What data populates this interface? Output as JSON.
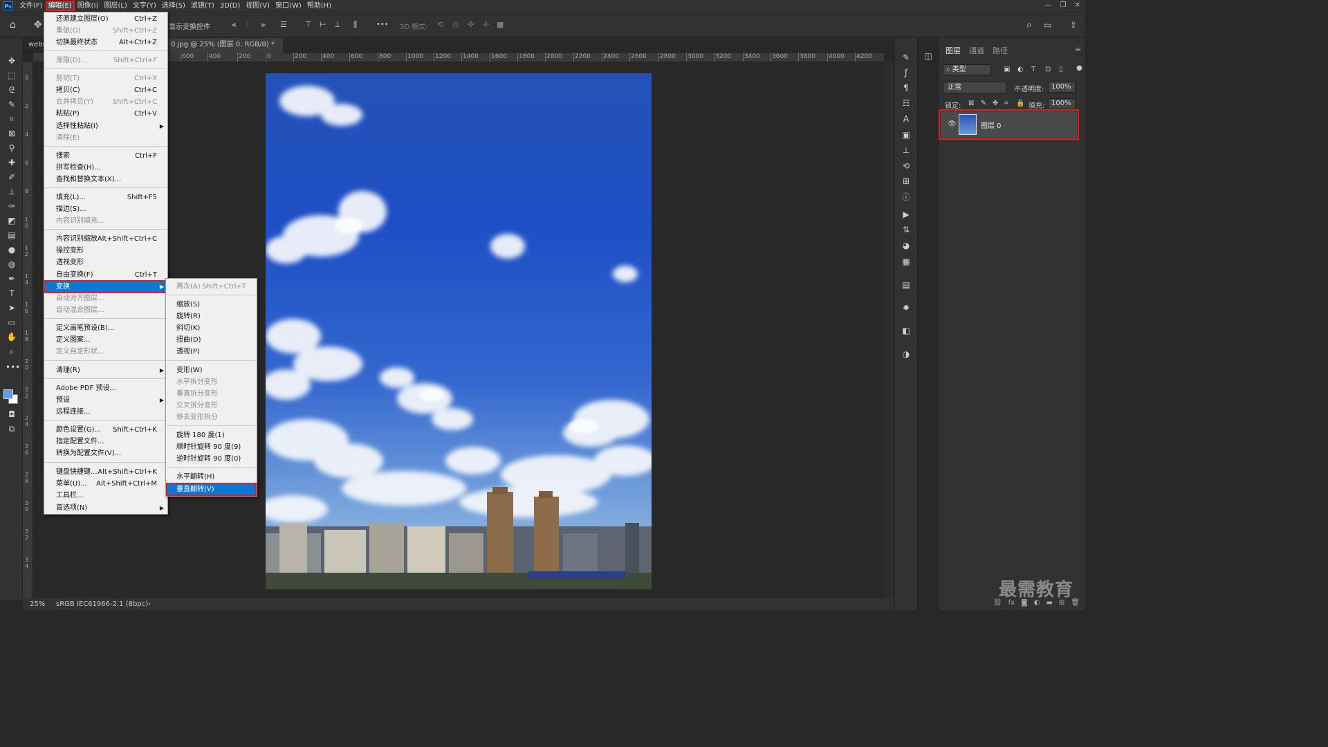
{
  "app": {
    "logo": "Ps"
  },
  "menubar": {
    "items": [
      "文件(F)",
      "编辑(E)",
      "图像(I)",
      "图层(L)",
      "文字(Y)",
      "选择(S)",
      "滤镜(T)",
      "3D(D)",
      "视图(V)",
      "窗口(W)",
      "帮助(H)"
    ],
    "active": "编辑(E)"
  },
  "window_controls": {
    "minimize": "—",
    "restore": "❐",
    "close": "✕"
  },
  "optionsbar": {
    "show_transform": "显示变换控件",
    "mode_3d": "3D 模式:",
    "more": "•••"
  },
  "document": {
    "tab_left": "webu",
    "tab_title": "0.jpg @ 25% (图层 0, RGB/8) *",
    "tab_close": "×",
    "zoom": "25%",
    "color_profile": "sRGB IEC61966-2.1 (8bpc)",
    "status_arrow": "›"
  },
  "ruler": {
    "top_labels": [
      "600",
      "400",
      "200",
      "0",
      "200",
      "400",
      "600",
      "800",
      "1000",
      "1200",
      "1400",
      "1600",
      "1800",
      "2000",
      "2200",
      "2400",
      "2600",
      "2800",
      "3000",
      "3200",
      "3400",
      "3600",
      "3800",
      "4000",
      "4200"
    ],
    "left_labels": [
      "0",
      "2",
      "4",
      "6",
      "8",
      "10",
      "12",
      "14",
      "16",
      "18",
      "20",
      "22",
      "24",
      "26",
      "28",
      "30",
      "32",
      "34"
    ]
  },
  "edit_menu": {
    "items": [
      {
        "label": "还原建立图层(O)",
        "shortcut": "Ctrl+Z",
        "disabled": false
      },
      {
        "label": "重做(O)",
        "shortcut": "Shift+Ctrl+Z",
        "disabled": true
      },
      {
        "label": "切换最终状态",
        "shortcut": "Alt+Ctrl+Z",
        "disabled": false
      },
      {
        "label": "渐隐(D)...",
        "shortcut": "Shift+Ctrl+F",
        "disabled": true
      },
      {
        "label": "剪切(T)",
        "shortcut": "Ctrl+X",
        "disabled": true
      },
      {
        "label": "拷贝(C)",
        "shortcut": "Ctrl+C",
        "disabled": false
      },
      {
        "label": "合并拷贝(Y)",
        "shortcut": "Shift+Ctrl+C",
        "disabled": true
      },
      {
        "label": "粘贴(P)",
        "shortcut": "Ctrl+V",
        "disabled": false
      },
      {
        "label": "选择性粘贴(I)",
        "shortcut": "",
        "disabled": false,
        "submenu": true
      },
      {
        "label": "清除(E)",
        "shortcut": "",
        "disabled": true
      },
      {
        "label": "搜索",
        "shortcut": "Ctrl+F",
        "disabled": false
      },
      {
        "label": "拼写检查(H)...",
        "shortcut": "",
        "disabled": false
      },
      {
        "label": "查找和替换文本(X)...",
        "shortcut": "",
        "disabled": false
      },
      {
        "label": "填充(L)...",
        "shortcut": "Shift+F5",
        "disabled": false
      },
      {
        "label": "描边(S)...",
        "shortcut": "",
        "disabled": false
      },
      {
        "label": "内容识别填充...",
        "shortcut": "",
        "disabled": true
      },
      {
        "label": "内容识别缩放",
        "shortcut": "Alt+Shift+Ctrl+C",
        "disabled": false
      },
      {
        "label": "操控变形",
        "shortcut": "",
        "disabled": false
      },
      {
        "label": "透视变形",
        "shortcut": "",
        "disabled": false
      },
      {
        "label": "自由变换(F)",
        "shortcut": "Ctrl+T",
        "disabled": false
      },
      {
        "label": "变换",
        "shortcut": "",
        "disabled": false,
        "submenu": true,
        "highlighted": true
      },
      {
        "label": "自动对齐图层...",
        "shortcut": "",
        "disabled": true
      },
      {
        "label": "自动混合图层...",
        "shortcut": "",
        "disabled": true
      },
      {
        "label": "定义画笔预设(B)...",
        "shortcut": "",
        "disabled": false
      },
      {
        "label": "定义图案...",
        "shortcut": "",
        "disabled": false
      },
      {
        "label": "定义自定形状...",
        "shortcut": "",
        "disabled": true
      },
      {
        "label": "清理(R)",
        "shortcut": "",
        "disabled": false,
        "submenu": true
      },
      {
        "label": "Adobe PDF 预设...",
        "shortcut": "",
        "disabled": false
      },
      {
        "label": "预设",
        "shortcut": "",
        "disabled": false,
        "submenu": true
      },
      {
        "label": "远程连接...",
        "shortcut": "",
        "disabled": false
      },
      {
        "label": "颜色设置(G)...",
        "shortcut": "Shift+Ctrl+K",
        "disabled": false
      },
      {
        "label": "指定配置文件...",
        "shortcut": "",
        "disabled": false
      },
      {
        "label": "转换为配置文件(V)...",
        "shortcut": "",
        "disabled": false
      },
      {
        "label": "键盘快捷键...",
        "shortcut": "Alt+Shift+Ctrl+K",
        "disabled": false
      },
      {
        "label": "菜单(U)...",
        "shortcut": "Alt+Shift+Ctrl+M",
        "disabled": false
      },
      {
        "label": "工具栏...",
        "shortcut": "",
        "disabled": false
      },
      {
        "label": "首选项(N)",
        "shortcut": "",
        "disabled": false,
        "submenu": true
      }
    ]
  },
  "transform_submenu": {
    "items": [
      {
        "label": "再次(A)",
        "shortcut": "Shift+Ctrl+T",
        "disabled": true
      },
      {
        "label": "缩放(S)",
        "shortcut": "",
        "disabled": false
      },
      {
        "label": "旋转(R)",
        "shortcut": "",
        "disabled": false
      },
      {
        "label": "斜切(K)",
        "shortcut": "",
        "disabled": false
      },
      {
        "label": "扭曲(D)",
        "shortcut": "",
        "disabled": false
      },
      {
        "label": "透视(P)",
        "shortcut": "",
        "disabled": false
      },
      {
        "label": "变形(W)",
        "shortcut": "",
        "disabled": false
      },
      {
        "label": "水平拆分变形",
        "shortcut": "",
        "disabled": true
      },
      {
        "label": "垂直拆分变形",
        "shortcut": "",
        "disabled": true
      },
      {
        "label": "交叉拆分变形",
        "shortcut": "",
        "disabled": true
      },
      {
        "label": "移去变形拆分",
        "shortcut": "",
        "disabled": true
      },
      {
        "label": "旋转 180 度(1)",
        "shortcut": "",
        "disabled": false
      },
      {
        "label": "顺时针旋转 90 度(9)",
        "shortcut": "",
        "disabled": false
      },
      {
        "label": "逆时针旋转 90 度(0)",
        "shortcut": "",
        "disabled": false
      },
      {
        "label": "水平翻转(H)",
        "shortcut": "",
        "disabled": false
      },
      {
        "label": "垂直翻转(V)",
        "shortcut": "",
        "disabled": false,
        "highlighted": true
      }
    ]
  },
  "layers_panel": {
    "tabs": [
      "图层",
      "通道",
      "路径"
    ],
    "active_tab": "图层",
    "filter_kind": "类型",
    "blend_mode": "正常",
    "opacity_label": "不透明度:",
    "opacity_value": "100%",
    "lock_label": "锁定:",
    "fill_label": "填充:",
    "fill_value": "100%",
    "layers": [
      {
        "name": "图层 0",
        "visible": true,
        "selected": true
      }
    ]
  },
  "watermark": "最需教育",
  "colors": {
    "foreground": "#5aa0e8",
    "background": "#ffffff",
    "highlight": "#0a78d7",
    "annotation_red": "#e02020"
  }
}
